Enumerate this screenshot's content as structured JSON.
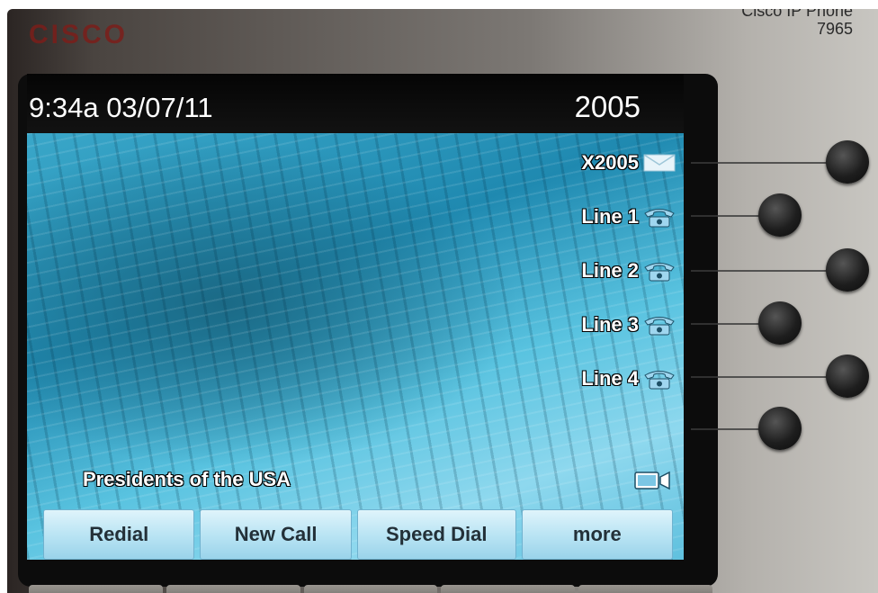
{
  "device": {
    "brand_logo": "CISCO",
    "model_line1": "Cisco IP Phone",
    "model_line2": "7965"
  },
  "header": {
    "clock_date": "9:34a 03/07/11",
    "phone_number": "2005"
  },
  "lines": [
    {
      "label": "X2005",
      "icon": "envelope-icon"
    },
    {
      "label": "Line 1",
      "icon": "phone-handset-icon"
    },
    {
      "label": "Line 2",
      "icon": "phone-handset-icon"
    },
    {
      "label": "Line 3",
      "icon": "phone-handset-icon"
    },
    {
      "label": "Line 4",
      "icon": "phone-handset-icon"
    }
  ],
  "status": {
    "presence_text": "Presidents of the USA",
    "video_icon": "video-camera-icon"
  },
  "softkeys": [
    {
      "label": "Redial"
    },
    {
      "label": "New Call"
    },
    {
      "label": "Speed Dial"
    },
    {
      "label": "more"
    }
  ],
  "colors": {
    "softkey_bg": "#b7e3f3",
    "header_bg": "#050505",
    "wallpaper_accent": "#3aa7c9",
    "phone_icon": "#9fd6ef",
    "logo": "#7b1e1a"
  }
}
